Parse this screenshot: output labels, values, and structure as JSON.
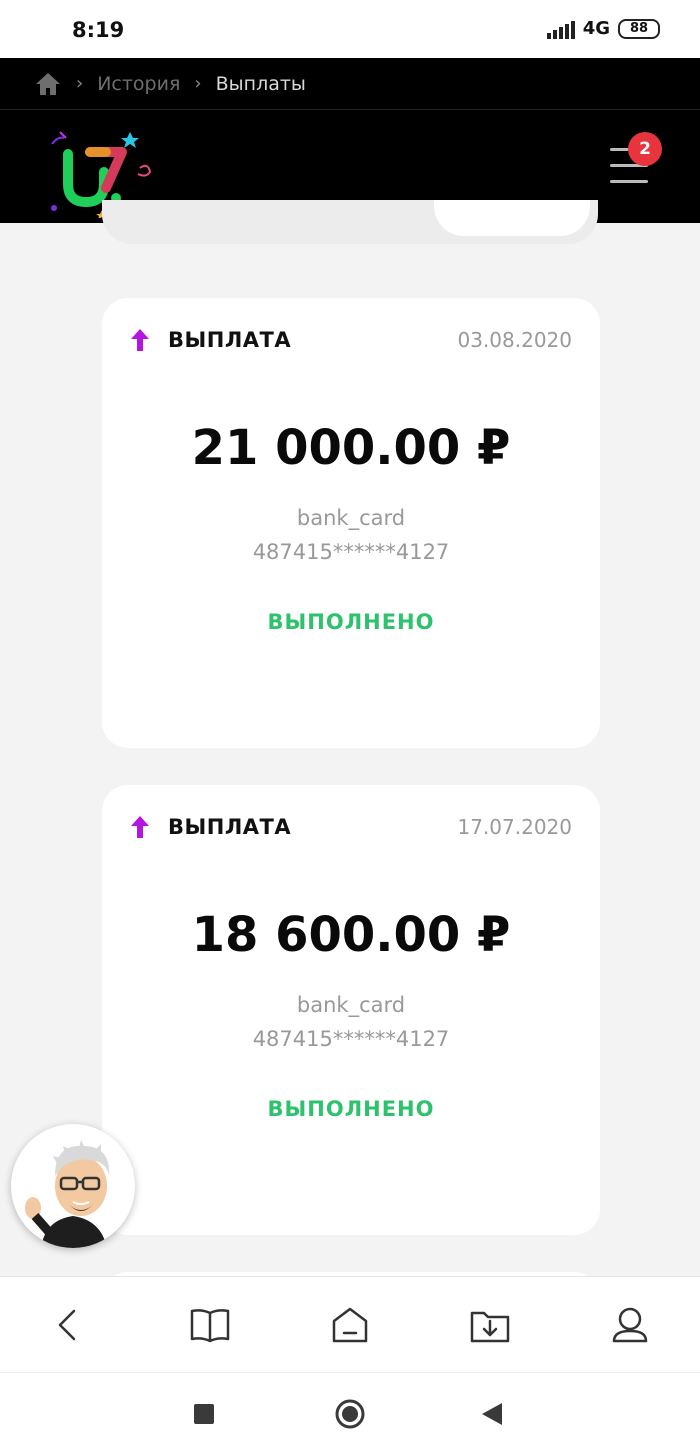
{
  "status_bar": {
    "time": "8:19",
    "network": "4G",
    "battery": "88"
  },
  "breadcrumb": {
    "items": [
      "История",
      "Выплаты"
    ]
  },
  "header": {
    "menu_badge": "2"
  },
  "payouts": [
    {
      "type": "ВЫПЛАТА",
      "date": "03.08.2020",
      "amount": "21 000.00 ₽",
      "method": "bank_card",
      "account": "487415******4127",
      "status": "ВЫПОЛНЕНО"
    },
    {
      "type": "ВЫПЛАТА",
      "date": "17.07.2020",
      "amount": "18 600.00 ₽",
      "method": "bank_card",
      "account": "487415******4127",
      "status": "ВЫПОЛНЕНО"
    }
  ],
  "colors": {
    "header_bg": "#000000",
    "accent_arrow": "#b515e0",
    "status_success": "#2dc26b",
    "badge": "#e8343d"
  }
}
